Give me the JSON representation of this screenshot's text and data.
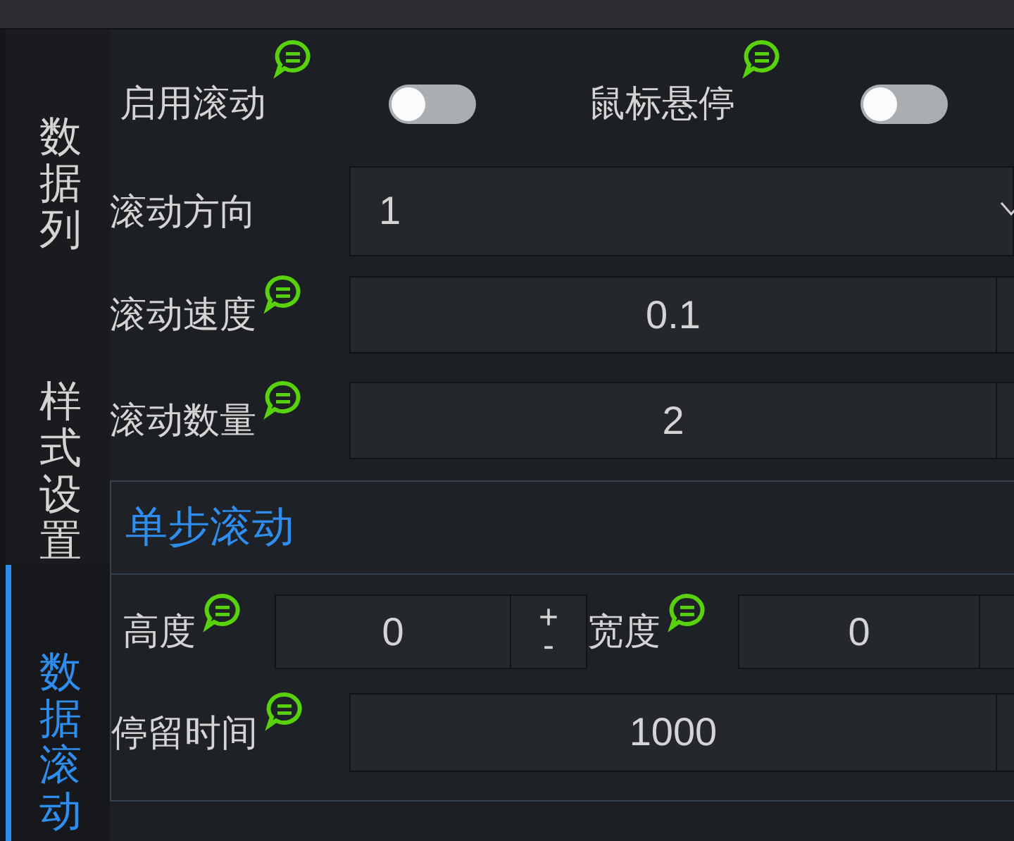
{
  "sidebar": {
    "tabs": [
      {
        "label": "数据列",
        "selected": false
      },
      {
        "label": "样式设置",
        "selected": false
      },
      {
        "label": "数据滚动",
        "selected": true
      }
    ]
  },
  "toggles": [
    {
      "label": "启用滚动",
      "hint": true,
      "on": false
    },
    {
      "label": "鼠标悬停",
      "hint": true,
      "on": false
    }
  ],
  "direction": {
    "label": "滚动方向",
    "hint": false,
    "value": "1"
  },
  "speed": {
    "label": "滚动速度",
    "hint": true,
    "value": "0.1"
  },
  "count": {
    "label": "滚动数量",
    "hint": true,
    "value": "2"
  },
  "step_group": {
    "title": "单步滚动",
    "height": {
      "label": "高度",
      "hint": true,
      "value": "0",
      "plus": "+",
      "minus": "-"
    },
    "width": {
      "label": "宽度",
      "hint": true,
      "value": "0"
    },
    "dwell": {
      "label": "停留时间",
      "hint": true,
      "value": "1000"
    }
  }
}
